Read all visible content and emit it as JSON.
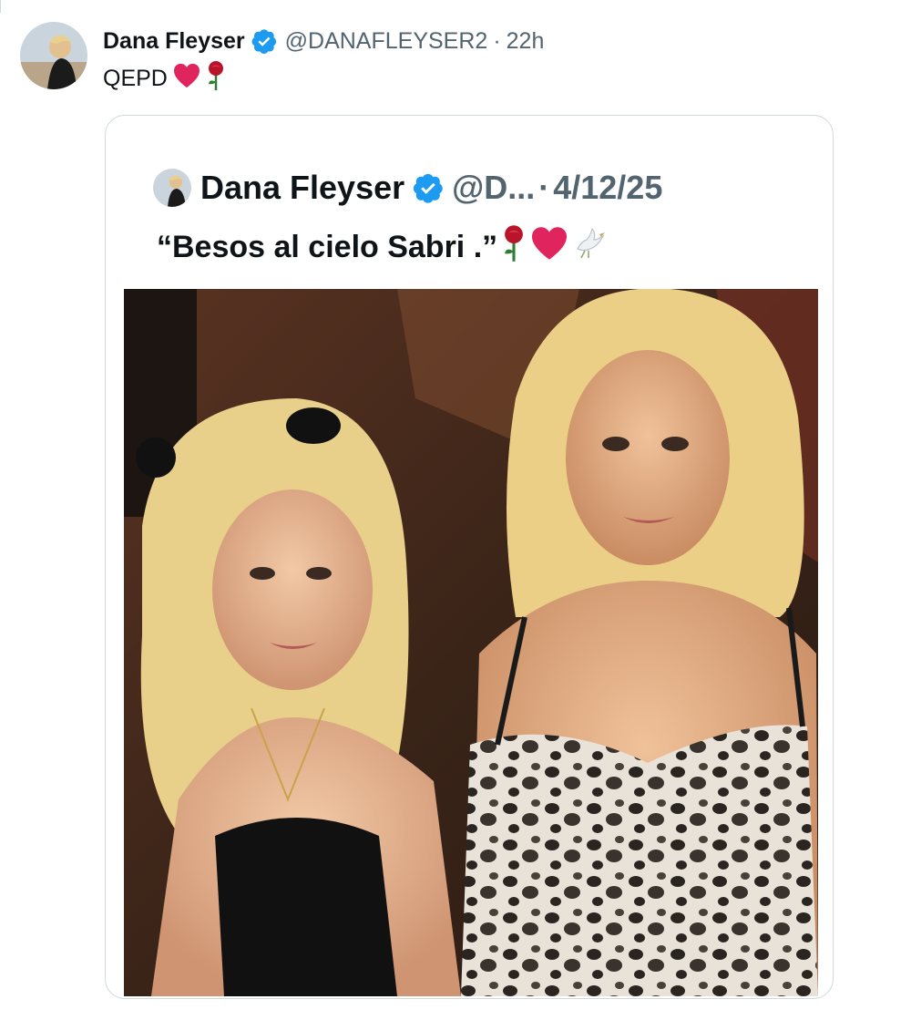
{
  "tweet": {
    "author_name": "Dana Fleyser",
    "handle": "@DANAFLEYSER2",
    "separator": "·",
    "time": "22h",
    "text": "QEPD",
    "text_emojis": [
      "heart-icon",
      "rose-icon"
    ]
  },
  "quoted": {
    "author_name": "Dana Fleyser",
    "handle": "@D...",
    "separator": "·",
    "date": "4/12/25",
    "text": "“Besos al cielo Sabri .”",
    "text_emojis": [
      "rose-icon",
      "heart-icon",
      "dove-icon"
    ]
  },
  "colors": {
    "verified": "#1d9bf0",
    "heart": "#e0245e",
    "rose": "#b8142a",
    "secondary_text": "#536471",
    "border": "#cfd9de"
  }
}
